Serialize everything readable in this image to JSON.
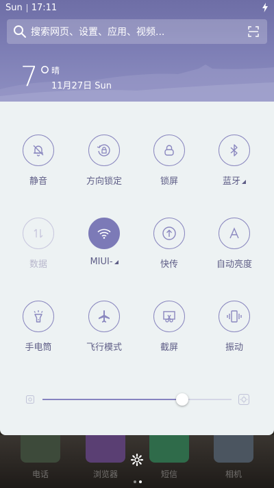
{
  "status_bar": {
    "day": "Sun",
    "time": "17:11"
  },
  "search": {
    "placeholder": "搜索网页、设置、应用、视频..."
  },
  "weather": {
    "temperature": "7°",
    "condition": "晴",
    "date": "11月27日 Sun"
  },
  "toggles": [
    {
      "label": "静音",
      "icon": "bell-off-icon",
      "state": "off"
    },
    {
      "label": "方向锁定",
      "icon": "rotation-lock-icon",
      "state": "off"
    },
    {
      "label": "锁屏",
      "icon": "lock-icon",
      "state": "off"
    },
    {
      "label": "蓝牙",
      "icon": "bluetooth-icon",
      "state": "off",
      "has_menu": true
    },
    {
      "label": "数据",
      "icon": "data-arrows-icon",
      "state": "disabled"
    },
    {
      "label": "MIUI-",
      "icon": "wifi-icon",
      "state": "on",
      "has_menu": true
    },
    {
      "label": "快传",
      "icon": "upload-icon",
      "state": "off"
    },
    {
      "label": "自动亮度",
      "icon": "auto-brightness-icon",
      "state": "off"
    },
    {
      "label": "手电筒",
      "icon": "flashlight-icon",
      "state": "off"
    },
    {
      "label": "飞行模式",
      "icon": "airplane-icon",
      "state": "off"
    },
    {
      "label": "截屏",
      "icon": "screenshot-icon",
      "state": "off"
    },
    {
      "label": "振动",
      "icon": "vibrate-icon",
      "state": "off"
    }
  ],
  "brightness": {
    "level": 0.74
  },
  "dock": {
    "apps": [
      {
        "label": "电话",
        "color": "#3d4a3a"
      },
      {
        "label": "浏览器",
        "color": "#5a3f73"
      },
      {
        "label": "短信",
        "color": "#2f6b4a"
      },
      {
        "label": "相机",
        "color": "#4b5560"
      }
    ],
    "pages": 2,
    "current_page": 2
  },
  "colors": {
    "accent": "#7c7ab7",
    "header": "#7c7db4",
    "panel": "#edf2f3"
  }
}
